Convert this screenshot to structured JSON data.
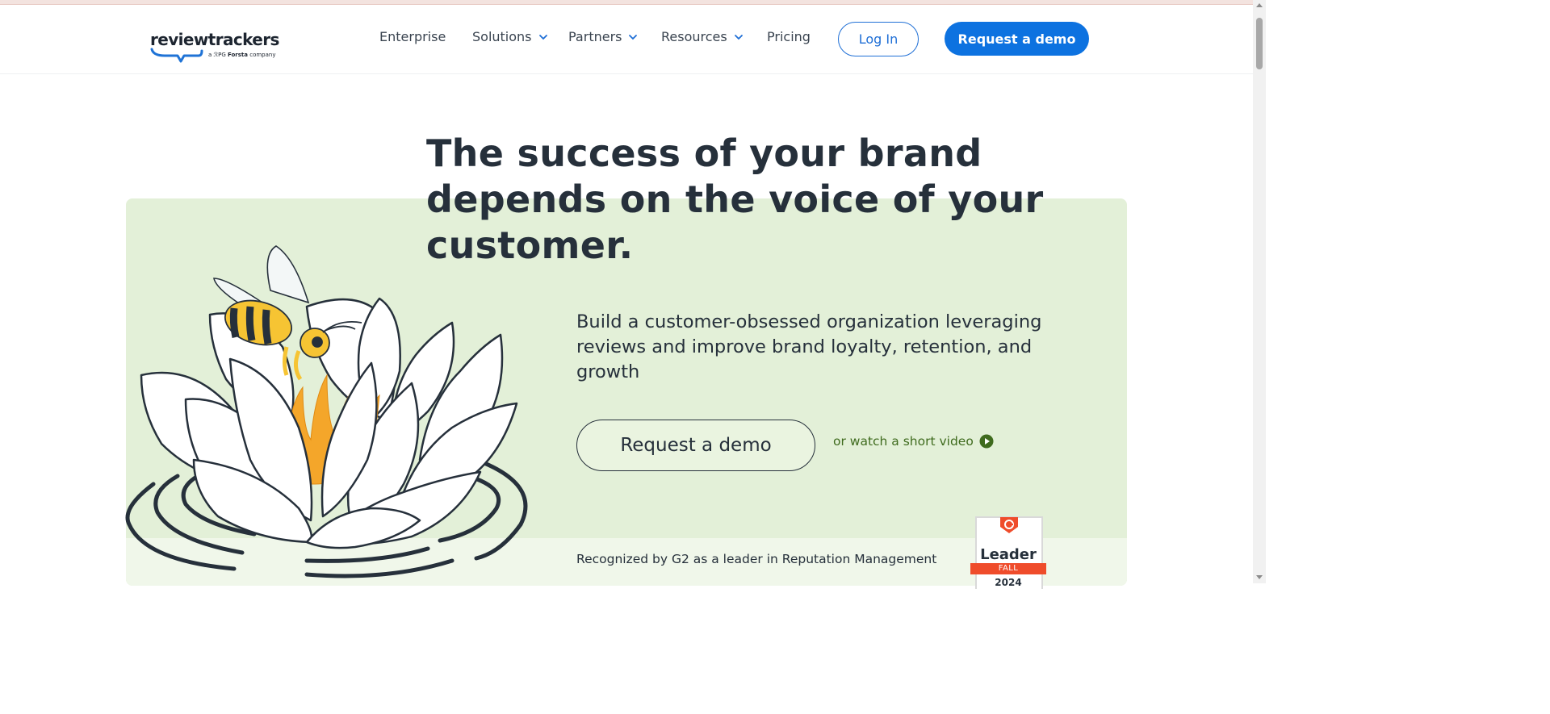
{
  "header": {
    "logo_text": "reviewtrackers",
    "logo_sub_prefix": "a",
    "logo_sub_brand": "Forsta",
    "logo_sub_suffix": "company",
    "nav": [
      {
        "label": "Enterprise",
        "has_dropdown": false
      },
      {
        "label": "Solutions",
        "has_dropdown": true
      },
      {
        "label": "Partners",
        "has_dropdown": true
      },
      {
        "label": "Resources",
        "has_dropdown": true
      },
      {
        "label": "Pricing",
        "has_dropdown": false
      }
    ],
    "login_label": "Log In",
    "demo_label": "Request a demo"
  },
  "hero": {
    "title": "The success of your brand depends on the voice of your customer.",
    "subtitle": "Build a customer-obsessed organization leveraging reviews and improve brand loyalty, retention, and growth",
    "cta_label": "Request a demo",
    "video_link": "or watch a short video",
    "recognized_text": "Recognized by G2 as a leader in Reputation Management"
  },
  "badge": {
    "title": "Leader",
    "season": "FALL",
    "year": "2024"
  },
  "colors": {
    "accent_blue": "#0d72e0",
    "hero_bg": "#e3f0d8",
    "link_green": "#3f6b1e",
    "text_dark": "#26303b",
    "g2_orange": "#ef4c2b"
  },
  "icons": [
    "chevron-down-icon",
    "play-circle-icon",
    "g2-logo-icon",
    "lotus-bee-illustration"
  ]
}
